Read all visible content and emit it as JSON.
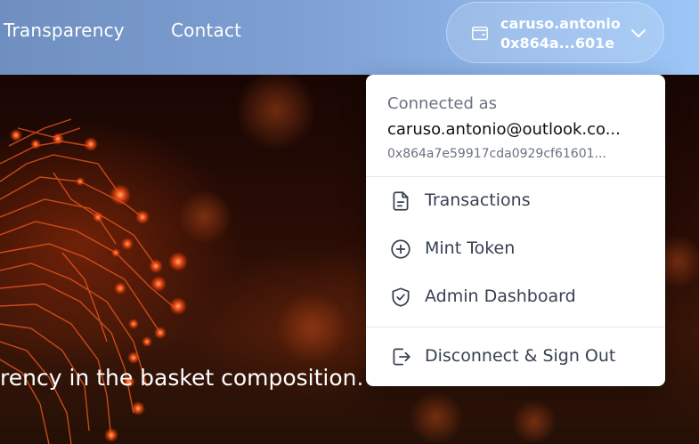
{
  "nav": {
    "links": [
      {
        "label": "Transparency"
      },
      {
        "label": "Contact"
      }
    ]
  },
  "wallet": {
    "name": "caruso.antonio",
    "address_short": "0x864a...601e",
    "icon": "wallet-icon",
    "chevron": "chevron-down-icon"
  },
  "hero": {
    "text": "rency in the basket composition."
  },
  "dropdown": {
    "connected_label": "Connected as",
    "email": "caruso.antonio@outlook.co...",
    "address": "0x864a7e59917cda0929cf61601...",
    "items": [
      {
        "label": "Transactions",
        "icon": "document-icon"
      },
      {
        "label": "Mint Token",
        "icon": "plus-circle-icon"
      },
      {
        "label": "Admin Dashboard",
        "icon": "shield-check-icon"
      },
      {
        "label": "Disconnect & Sign Out",
        "icon": "sign-out-icon"
      }
    ]
  },
  "colors": {
    "header_gradient_start": "#6f8fc0",
    "header_gradient_end": "#9cc6f6",
    "hero_glow": "#ff5a1f",
    "menu_text": "#374151",
    "muted_text": "#6b7280"
  }
}
